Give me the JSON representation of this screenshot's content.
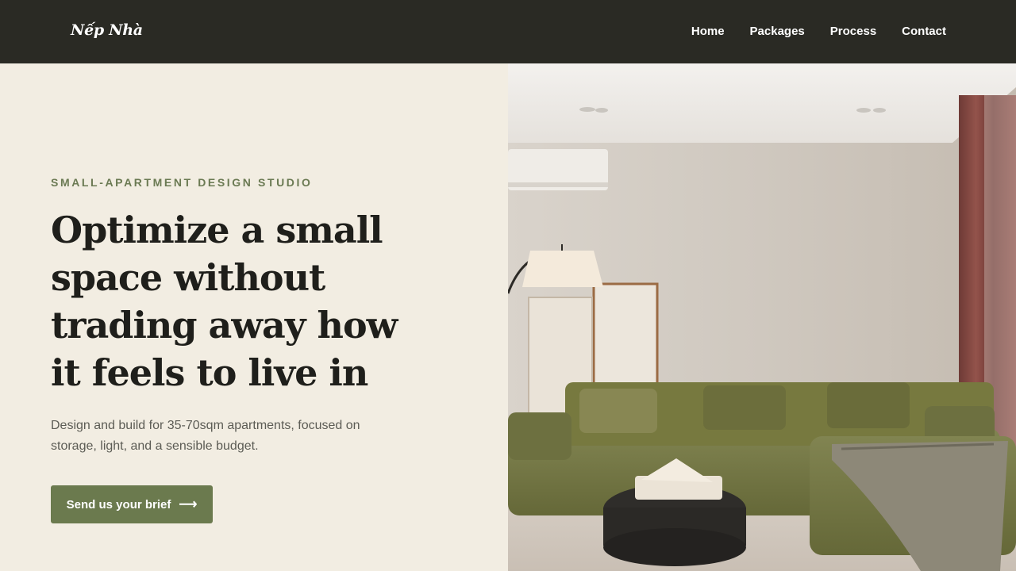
{
  "brand": {
    "name": "Nếp Nhà"
  },
  "nav": {
    "items": [
      "Home",
      "Packages",
      "Process",
      "Contact"
    ]
  },
  "hero": {
    "eyebrow": "SMALL-APARTMENT DESIGN STUDIO",
    "headline": "Optimize a small space without trading away how it feels to live in",
    "subtext": "Design and build for 35-70sqm apartments, focused on storage, light, and a sensible budget.",
    "cta_label": "Send us your brief",
    "cta_icon": "arrow-right-icon"
  },
  "image": {
    "subject": "living-room-photo"
  },
  "colors": {
    "nav_bg": "#2a2a24",
    "page_bg": "#f2ede2",
    "accent": "#6b7a4e",
    "eyebrow": "#6b7a53"
  }
}
